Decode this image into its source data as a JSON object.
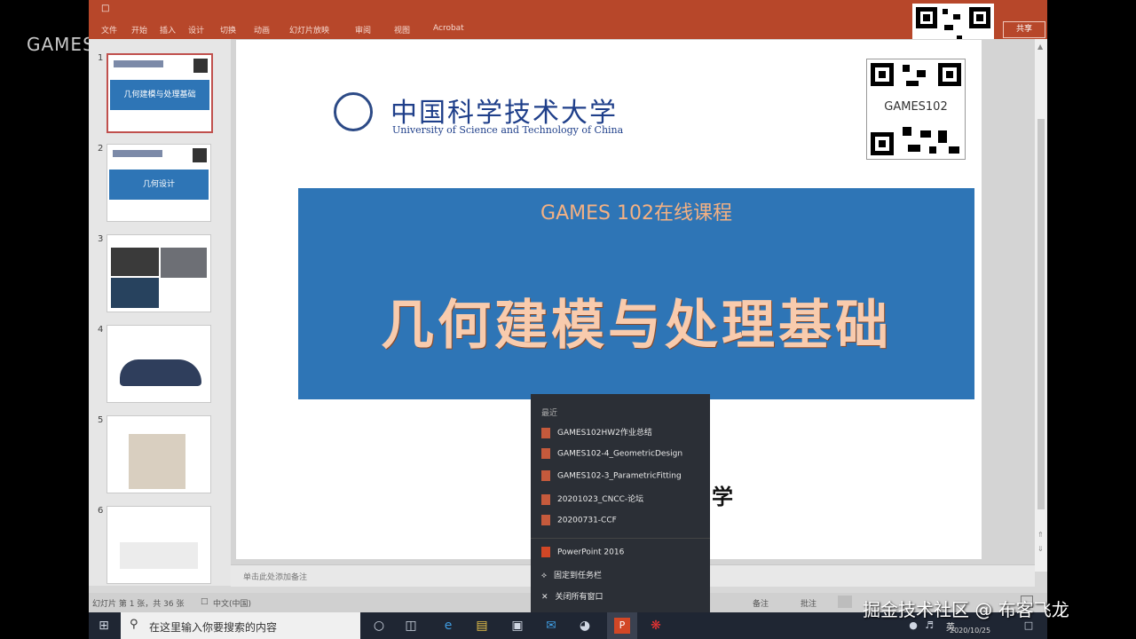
{
  "overlay": {
    "webinar": "GAMES Webinar",
    "watermark": "掘金技术社区 @ 布客飞龙"
  },
  "window": {
    "ribbon_tabs": [
      "文件",
      "开始",
      "插入",
      "设计",
      "切换",
      "动画",
      "幻灯片放映",
      "审阅",
      "视图",
      "Acrobat"
    ],
    "share": "共享"
  },
  "thumbnails": [
    {
      "num": "1",
      "title": "几何建模与处理基础"
    },
    {
      "num": "2",
      "title": "几何设计"
    },
    {
      "num": "3"
    },
    {
      "num": "4"
    },
    {
      "num": "5"
    },
    {
      "num": "6"
    }
  ],
  "slide": {
    "logo_cn": "中国科学技术大学",
    "logo_en": "University of Science and Technology of China",
    "qr_label": "GAMES102",
    "subtitle": "GAMES 102在线课程",
    "title": "几何建模与处理基础",
    "peek_text": "学"
  },
  "notes_placeholder": "单击此处添加备注",
  "status": {
    "left": "幻灯片 第 1 张，共 36 张",
    "lang": "中文(中国)",
    "notes": "备注",
    "comments": "批注"
  },
  "taskbar": {
    "search_placeholder": "在这里输入你要搜索的内容",
    "ime": "英",
    "date": "2020/10/25"
  },
  "jumplist": {
    "header": "最近",
    "recent": [
      "GAMES102HW2作业总结",
      "GAMES102-4_GeometricDesign",
      "GAMES102-3_ParametricFitting",
      "20201023_CNCC-论坛",
      "20200731-CCF"
    ],
    "app": "PowerPoint 2016",
    "pin": "固定到任务栏",
    "close_all": "关闭所有窗口"
  },
  "colors": {
    "accent": "#b7472a",
    "banner": "#2e75b6",
    "title_text": "#f8cbad"
  }
}
